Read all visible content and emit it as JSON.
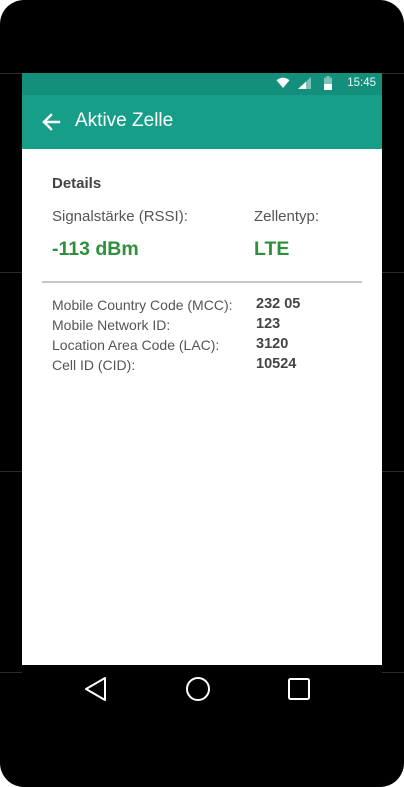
{
  "status_bar": {
    "time": "15:45",
    "icons": [
      "wifi-icon",
      "cell-signal-icon",
      "battery-icon"
    ]
  },
  "app_bar": {
    "title": "Aktive Zelle",
    "back_icon": "arrow-left-icon"
  },
  "details": {
    "section_title": "Details",
    "signal_label": "Signalstärke (RSSI):",
    "signal_value": "-113 dBm",
    "cell_type_label": "Zellentyp:",
    "cell_type_value": "LTE",
    "rows": [
      {
        "label": "Mobile Country Code (MCC):",
        "value": "232 05"
      },
      {
        "label": "Mobile Network ID:",
        "value": "123"
      },
      {
        "label": "Location Area Code (LAC):",
        "value": "3120"
      },
      {
        "label": "Cell ID (CID):",
        "value": "10524"
      }
    ]
  },
  "nav_bar": {
    "icons": [
      "back-triangle-icon",
      "home-circle-icon",
      "recents-square-icon"
    ]
  },
  "colors": {
    "status_bar": "#138f7c",
    "app_bar": "#179e89",
    "accent_value": "#2f8f3b",
    "text_label": "#555555",
    "text_strong": "#444444",
    "divider": "#c7c7c7"
  }
}
